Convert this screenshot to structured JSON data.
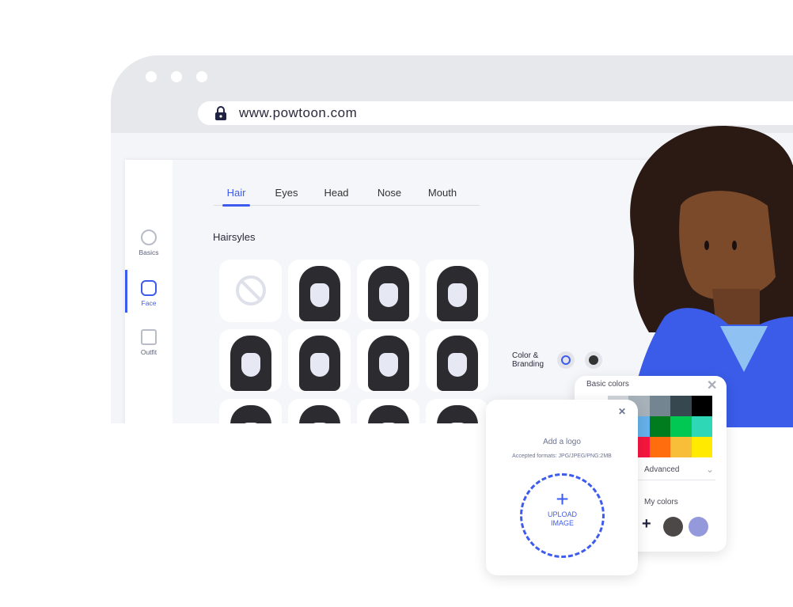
{
  "browser": {
    "url": "www.powtoon.com"
  },
  "sidebar": {
    "items": [
      {
        "label": "Basics",
        "icon": "fingerprint-icon"
      },
      {
        "label": "Face",
        "icon": "face-scan-icon",
        "active": true
      },
      {
        "label": "Outfit",
        "icon": "shirt-icon"
      }
    ]
  },
  "tabs": [
    {
      "label": "Hair",
      "active": true
    },
    {
      "label": "Eyes"
    },
    {
      "label": "Head"
    },
    {
      "label": "Nose"
    },
    {
      "label": "Mouth"
    }
  ],
  "section_title": "Hairsyles",
  "branding": {
    "label1": "Color &",
    "label2": "Branding",
    "selected_color": "#333333"
  },
  "basic_colors": {
    "title": "Basic colors",
    "advanced": "Advanced",
    "my_colors_title": "My colors",
    "my_colors": [
      "#4d4848",
      "#9499dc"
    ],
    "swatches": [
      "#ffffff",
      "#cfd4da",
      "#a7b1ba",
      "#738591",
      "#37474f",
      "#000000",
      "#90caf9",
      "#5aa8ec",
      "#64b0e8",
      "#007b1e",
      "#00c853",
      "#2ed8b6",
      "#e91e63",
      "#f50057",
      "#f5163f",
      "#ff6d0f",
      "#f8be3a",
      "#ffea00"
    ]
  },
  "logo": {
    "title": "Add a logo",
    "formats": "Accepted formats: JPG/JPEG/PNG:2MB",
    "upload1": "UPLOAD",
    "upload2": "IMAGE"
  },
  "accent": "#3e5bf0"
}
